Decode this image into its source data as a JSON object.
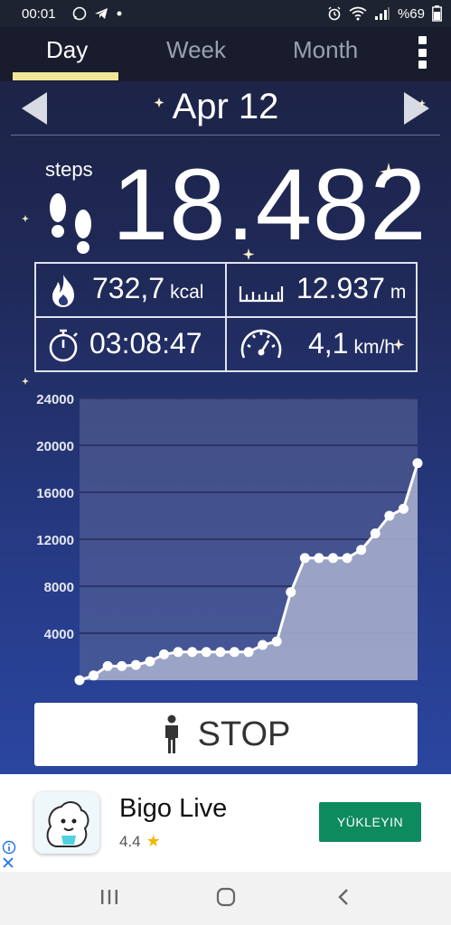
{
  "status_bar": {
    "time": "00:01",
    "battery": "%69"
  },
  "tabs": [
    {
      "label": "Day",
      "active": true
    },
    {
      "label": "Week",
      "active": false
    },
    {
      "label": "Month",
      "active": false
    }
  ],
  "date": "Apr 12",
  "steps": {
    "label": "steps",
    "value": "18.482"
  },
  "stats": {
    "calories": {
      "value": "732,7",
      "unit": "kcal",
      "icon": "flame-icon"
    },
    "distance": {
      "value": "12.937",
      "unit": "m",
      "icon": "ruler-icon"
    },
    "duration": {
      "value": "03:08:47",
      "icon": "stopwatch-icon"
    },
    "speed": {
      "value": "4,1",
      "unit": "km/h",
      "icon": "speedometer-icon"
    }
  },
  "stop_button": {
    "label": "STOP",
    "icon": "person-icon"
  },
  "ad": {
    "title": "Bigo Live",
    "rating": "4.4",
    "cta": "YÜKLEYIN"
  },
  "colors": {
    "tab_indicator": "#f0e698",
    "ad_cta": "#0e8a5f",
    "chart_fill": "#a9b1cf"
  },
  "chart_data": {
    "type": "area",
    "x": [
      0,
      1,
      2,
      3,
      4,
      5,
      6,
      7,
      8,
      9,
      10,
      11,
      12,
      13,
      14,
      15,
      16,
      17,
      18,
      19,
      20,
      21,
      22,
      23,
      24
    ],
    "values": [
      0,
      400,
      1200,
      1200,
      1300,
      1600,
      2200,
      2400,
      2400,
      2400,
      2400,
      2400,
      2400,
      3000,
      3300,
      7500,
      10400,
      10400,
      10400,
      10400,
      11100,
      12500,
      14000,
      14600,
      18482
    ],
    "x_ticks": [
      2,
      4,
      6,
      8,
      10,
      12,
      14,
      16,
      18,
      20,
      22,
      24
    ],
    "y_ticks": [
      4000,
      8000,
      12000,
      16000,
      20000,
      24000
    ],
    "ylim": [
      0,
      24000
    ],
    "xlim": [
      0,
      24
    ],
    "grid": true
  }
}
